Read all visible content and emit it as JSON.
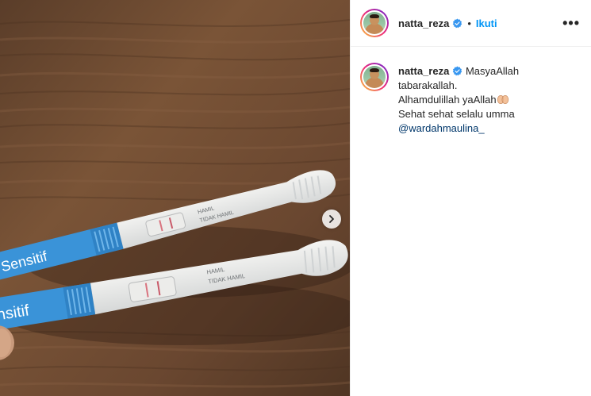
{
  "post": {
    "username": "natta_reza",
    "follow_label": "Ikuti",
    "more_label": "•••",
    "separator": "•"
  },
  "caption": {
    "username": "natta_reza",
    "line1": "MasyaAllah tabarakallah.",
    "line2": "Alhamdulillah yaAllah",
    "line3": "Sehat sehat selalu umma",
    "mention": "@wardahmaulina_"
  },
  "photo": {
    "brand_text": "Sensitif",
    "brand_text_lower": "nsitif",
    "label_positive": "HAMIL",
    "label_negative": "TIDAK HAMIL"
  },
  "icons": {
    "verified": "verified-badge-icon",
    "next": "chevron-right-icon",
    "emoji": "praying-hands-emoji"
  },
  "colors": {
    "accent": "#0095f6",
    "verified": "#3897f0",
    "brand_blue": "#2e8fd6"
  }
}
